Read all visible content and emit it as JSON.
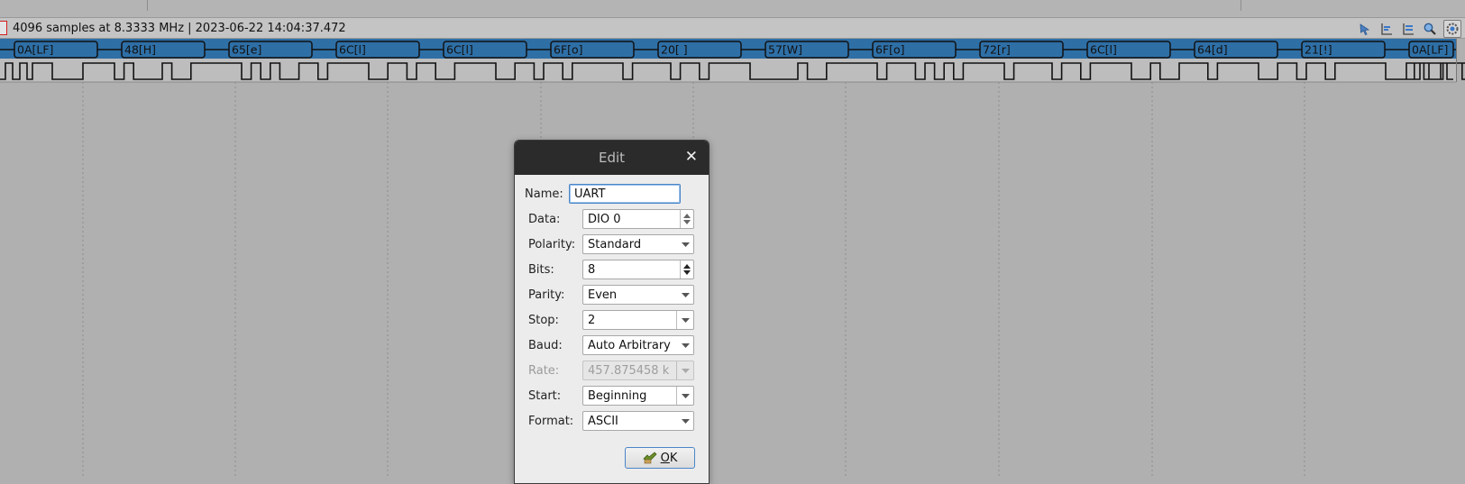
{
  "status": {
    "text": "4096 samples at 8.3333 MHz | 2023-06-22 14:04:37.472"
  },
  "toolbar": {
    "icons": [
      "cursor-arrow-icon",
      "zoom-fit-icon",
      "zoom-one-to-one-icon",
      "magnifier-icon",
      "gear-refresh-icon"
    ]
  },
  "decoder": {
    "bytes": [
      "0A[LF]",
      "48[H]",
      "65[e]",
      "6C[l]",
      "6C[l]",
      "6F[o]",
      "20[ ]",
      "57[W]",
      "6F[o]",
      "72[r]",
      "6C[l]",
      "64[d]",
      "21[!]",
      "0A[LF]"
    ]
  },
  "dialog": {
    "title": "Edit",
    "name_label": "Name:",
    "name_value": "UART",
    "data_label": "Data:",
    "data_value": "DIO 0",
    "polarity_label": "Polarity:",
    "polarity_value": "Standard",
    "bits_label": "Bits:",
    "bits_value": "8",
    "parity_label": "Parity:",
    "parity_value": "Even",
    "stop_label": "Stop:",
    "stop_value": "2",
    "baud_label": "Baud:",
    "baud_value": "Auto Arbitrary",
    "rate_label": "Rate:",
    "rate_value": "457.875458 k",
    "start_label": "Start:",
    "start_value": "Beginning",
    "format_label": "Format:",
    "format_value": "ASCII",
    "ok_first": "O",
    "ok_rest": "K"
  }
}
